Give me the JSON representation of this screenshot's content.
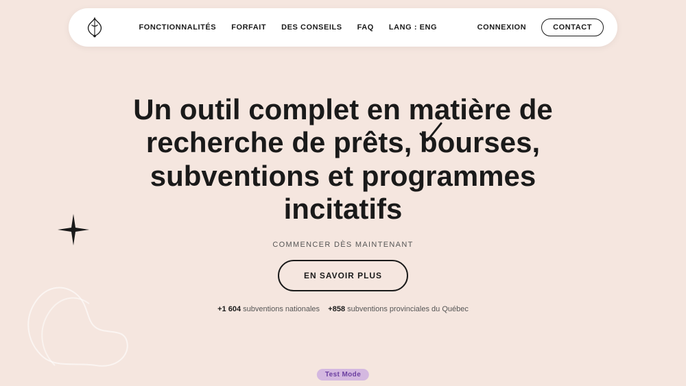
{
  "nav": {
    "links": [
      {
        "label": "FONCTIONNALITÉS",
        "name": "fonctionnalites-link"
      },
      {
        "label": "FORFAIT",
        "name": "forfait-link"
      },
      {
        "label": "DES CONSEILS",
        "name": "des-conseils-link"
      },
      {
        "label": "FAQ",
        "name": "faq-link"
      },
      {
        "label": "LANG : ENG",
        "name": "lang-link"
      }
    ],
    "connexion_label": "CONNEXION",
    "contact_label": "CONTACT"
  },
  "hero": {
    "title": "Un outil complet en matière de recherche de prêts, bourses, subventions et programmes incitatifs",
    "subtitle": "COMMENCER DÈS MAINTENANT",
    "cta_label": "EN SAVOIR PLUS",
    "stats": {
      "national": "+1 604",
      "national_label": "subventions nationales",
      "provincial": "+858",
      "provincial_label": "subventions provinciales du Québec"
    }
  },
  "test_mode_label": "Test Mode"
}
